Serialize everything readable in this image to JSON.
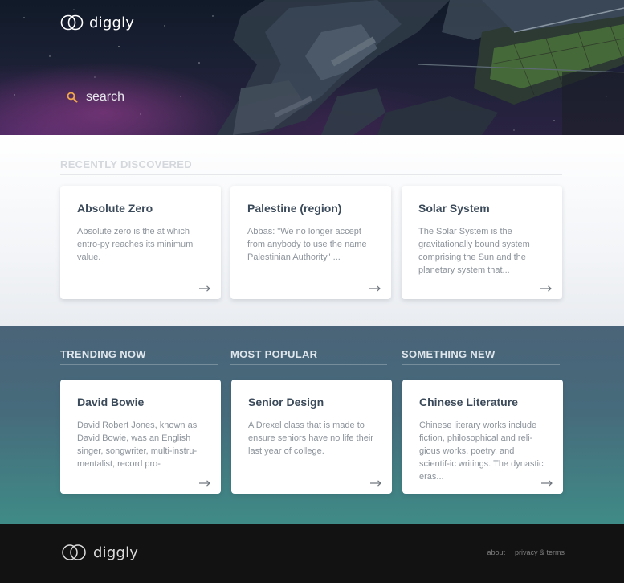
{
  "header": {
    "logo_text": "diggly",
    "search": {
      "placeholder": "search",
      "value": ""
    }
  },
  "recent": {
    "title": "RECENTLY DISCOVERED",
    "cards": [
      {
        "title": "Absolute Zero",
        "text": "Absolute zero is the at which entro-py reaches its minimum value."
      },
      {
        "title": "Palestine (region)",
        "text": "Abbas: \"We no longer accept from anybody to use the name Palestinian Authority\" ..."
      },
      {
        "title": "Solar System",
        "text": "The Solar System is the gravitationally bound system comprising the Sun and the planetary system that..."
      }
    ]
  },
  "lists": [
    {
      "title": "TRENDING NOW",
      "card": {
        "title": "David Bowie",
        "text": "David Robert Jones, known as David Bowie, was an English singer, songwriter, multi-instru-mentalist, record pro-"
      }
    },
    {
      "title": "MOST POPULAR",
      "card": {
        "title": "Senior Design",
        "text": "A Drexel class that is made to ensure seniors have no life their last year of college."
      }
    },
    {
      "title": "SOMETHING NEW",
      "card": {
        "title": "Chinese Literature",
        "text": "Chinese literary works include fiction, philosophical and reli-gious works, poetry, and scientif-ic writings. The dynastic eras..."
      }
    }
  ],
  "footer": {
    "logo_text": "diggly",
    "links": [
      "about",
      "privacy & terms"
    ]
  },
  "icons": {
    "logo": "two-interlocking-rings-icon",
    "search": "magnifier-icon",
    "card_arrow": "right-arrow-icon"
  },
  "colors": {
    "search_icon": "#f0a64a",
    "card_title": "#3b4a5a",
    "footer_bg": "#121212"
  }
}
